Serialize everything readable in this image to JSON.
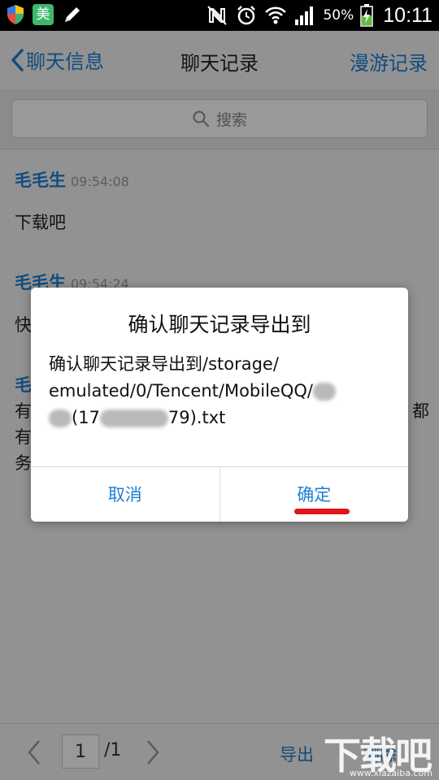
{
  "status_bar": {
    "app_icon": "美",
    "battery_percent": "50%",
    "time": "10:11"
  },
  "header": {
    "back_label": "聊天信息",
    "title": "聊天记录",
    "roam_label": "漫游记录"
  },
  "search": {
    "placeholder": "搜索"
  },
  "messages": [
    {
      "sender": "毛毛生",
      "time": "09:54:08",
      "text": "下载吧"
    },
    {
      "sender": "毛毛生",
      "time": "09:54:24",
      "text": "快"
    },
    {
      "sender": "毛",
      "text": "有",
      "text_line1_end": "都",
      "text_line2": "有",
      "text_line3": "务"
    }
  ],
  "pager": {
    "current": "1",
    "total": "/1"
  },
  "bottom_actions": {
    "export": "导出",
    "delete": "删除"
  },
  "dialog": {
    "title": "确认聊天记录导出到",
    "line1": "确认聊天记录导出到/storage/",
    "line2": "emulated/0/Tencent/MobileQQ/",
    "line3_a": "(17",
    "line3_b": "79).txt",
    "cancel": "取消",
    "confirm": "确定"
  },
  "watermark": {
    "big": "下载吧",
    "small": "www.xiazaiba.com"
  },
  "colors": {
    "accent": "#1e7fd4",
    "highlight": "#e0141b"
  }
}
